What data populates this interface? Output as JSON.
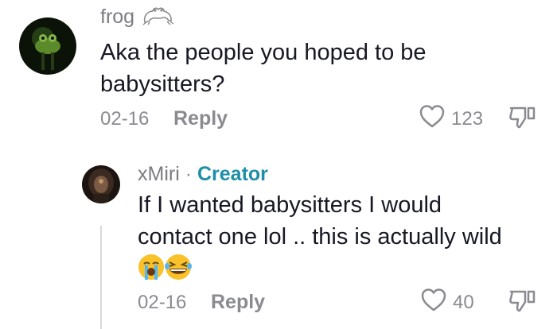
{
  "comment": {
    "author": "frog",
    "text_line1": "Aka the people you hoped to be",
    "text_line2": "babysitters?",
    "date": "02-16",
    "reply_label": "Reply",
    "likes": "123"
  },
  "reply": {
    "author": "xMiri",
    "separator": "·",
    "badge": "Creator",
    "text_line1": "If I wanted babysitters I would",
    "text_line2": "contact one lol .. this is actually wild",
    "emojis": [
      "crying-face",
      "laughing-face"
    ],
    "date": "02-16",
    "reply_label": "Reply",
    "likes": "40"
  },
  "colors": {
    "accent": "#1f8ea8",
    "muted": "#8a8b91",
    "text": "#161823"
  }
}
